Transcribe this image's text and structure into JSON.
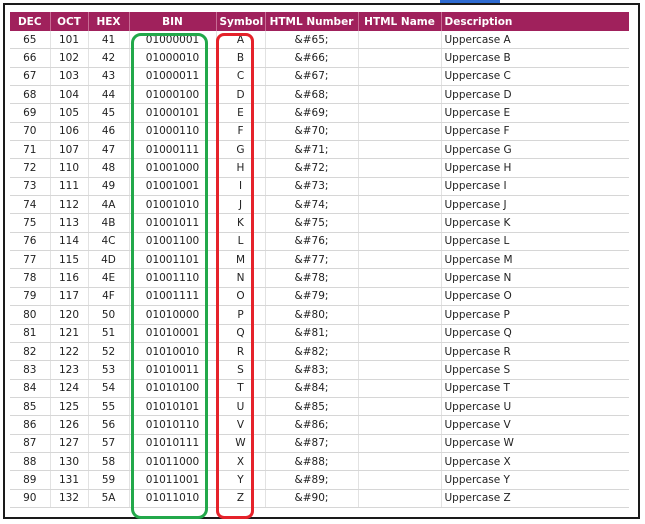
{
  "headers": [
    "DEC",
    "OCT",
    "HEX",
    "BIN",
    "Symbol",
    "HTML Number",
    "HTML Name",
    "Description"
  ],
  "rows": [
    [
      "65",
      "101",
      "41",
      "01000001",
      "A",
      "&#65;",
      "",
      "Uppercase A"
    ],
    [
      "66",
      "102",
      "42",
      "01000010",
      "B",
      "&#66;",
      "",
      "Uppercase B"
    ],
    [
      "67",
      "103",
      "43",
      "01000011",
      "C",
      "&#67;",
      "",
      "Uppercase C"
    ],
    [
      "68",
      "104",
      "44",
      "01000100",
      "D",
      "&#68;",
      "",
      "Uppercase D"
    ],
    [
      "69",
      "105",
      "45",
      "01000101",
      "E",
      "&#69;",
      "",
      "Uppercase E"
    ],
    [
      "70",
      "106",
      "46",
      "01000110",
      "F",
      "&#70;",
      "",
      "Uppercase F"
    ],
    [
      "71",
      "107",
      "47",
      "01000111",
      "G",
      "&#71;",
      "",
      "Uppercase G"
    ],
    [
      "72",
      "110",
      "48",
      "01001000",
      "H",
      "&#72;",
      "",
      "Uppercase H"
    ],
    [
      "73",
      "111",
      "49",
      "01001001",
      "I",
      "&#73;",
      "",
      "Uppercase I"
    ],
    [
      "74",
      "112",
      "4A",
      "01001010",
      "J",
      "&#74;",
      "",
      "Uppercase J"
    ],
    [
      "75",
      "113",
      "4B",
      "01001011",
      "K",
      "&#75;",
      "",
      "Uppercase K"
    ],
    [
      "76",
      "114",
      "4C",
      "01001100",
      "L",
      "&#76;",
      "",
      "Uppercase L"
    ],
    [
      "77",
      "115",
      "4D",
      "01001101",
      "M",
      "&#77;",
      "",
      "Uppercase M"
    ],
    [
      "78",
      "116",
      "4E",
      "01001110",
      "N",
      "&#78;",
      "",
      "Uppercase N"
    ],
    [
      "79",
      "117",
      "4F",
      "01001111",
      "O",
      "&#79;",
      "",
      "Uppercase O"
    ],
    [
      "80",
      "120",
      "50",
      "01010000",
      "P",
      "&#80;",
      "",
      "Uppercase P"
    ],
    [
      "81",
      "121",
      "51",
      "01010001",
      "Q",
      "&#81;",
      "",
      "Uppercase Q"
    ],
    [
      "82",
      "122",
      "52",
      "01010010",
      "R",
      "&#82;",
      "",
      "Uppercase R"
    ],
    [
      "83",
      "123",
      "53",
      "01010011",
      "S",
      "&#83;",
      "",
      "Uppercase S"
    ],
    [
      "84",
      "124",
      "54",
      "01010100",
      "T",
      "&#84;",
      "",
      "Uppercase T"
    ],
    [
      "85",
      "125",
      "55",
      "01010101",
      "U",
      "&#85;",
      "",
      "Uppercase U"
    ],
    [
      "86",
      "126",
      "56",
      "01010110",
      "V",
      "&#86;",
      "",
      "Uppercase V"
    ],
    [
      "87",
      "127",
      "57",
      "01010111",
      "W",
      "&#87;",
      "",
      "Uppercase W"
    ],
    [
      "88",
      "130",
      "58",
      "01011000",
      "X",
      "&#88;",
      "",
      "Uppercase X"
    ],
    [
      "89",
      "131",
      "59",
      "01011001",
      "Y",
      "&#89;",
      "",
      "Uppercase Y"
    ],
    [
      "90",
      "132",
      "5A",
      "01011010",
      "Z",
      "&#90;",
      "",
      "Uppercase Z"
    ]
  ],
  "colors": {
    "header_bg": "#a0215c",
    "header_text": "#ffffff",
    "highlight_bin": "#22a84a",
    "highlight_symbol": "#e5222a"
  }
}
